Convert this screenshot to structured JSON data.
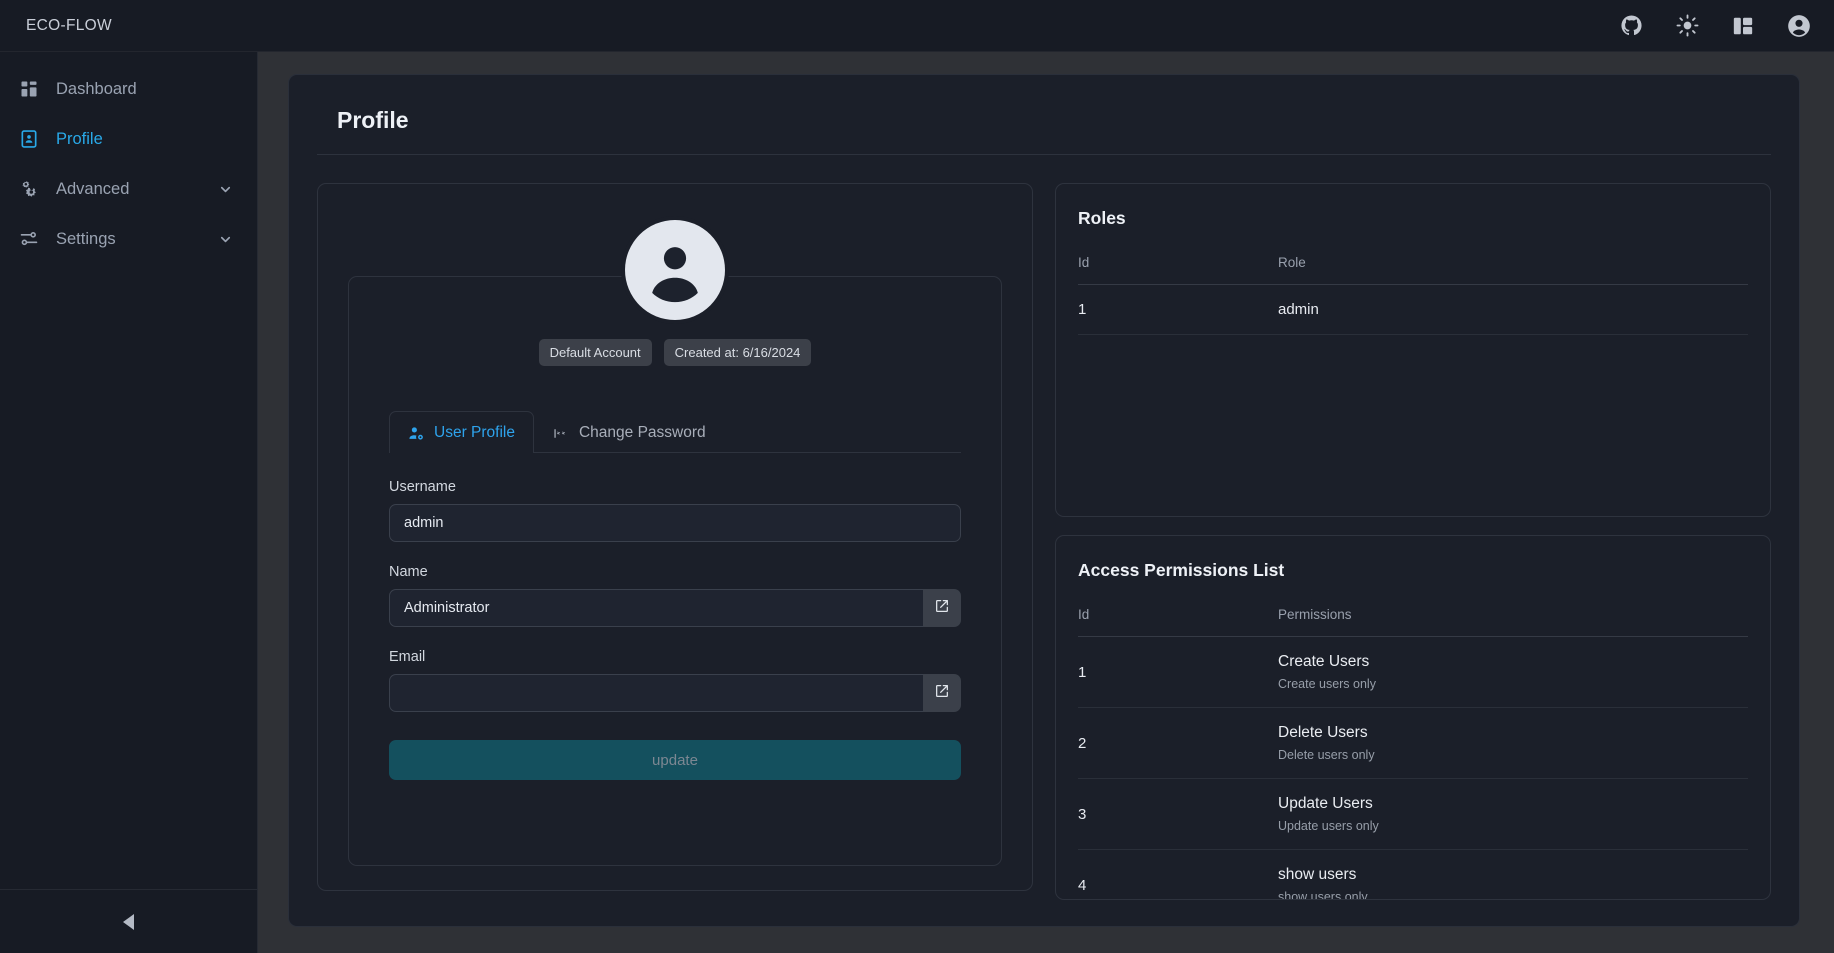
{
  "topbar": {
    "brand": "ECO-FLOW",
    "icons": [
      {
        "name": "github-icon",
        "label": "GitHub"
      },
      {
        "name": "sun-icon",
        "label": "Toggle theme"
      },
      {
        "name": "layout-panel-icon",
        "label": "Layout"
      },
      {
        "name": "account-circle-icon",
        "label": "Account"
      }
    ]
  },
  "sidebar": {
    "items": [
      {
        "label": "Dashboard",
        "icon": "dashboard-grid-icon",
        "active": false,
        "expandable": false
      },
      {
        "label": "Profile",
        "icon": "profile-card-icon",
        "active": true,
        "expandable": false
      },
      {
        "label": "Advanced",
        "icon": "gear-settings-icon",
        "active": false,
        "expandable": true
      },
      {
        "label": "Settings",
        "icon": "sliders-icon",
        "active": false,
        "expandable": true
      }
    ],
    "collapse_label": "Collapse sidebar"
  },
  "page": {
    "title": "Profile"
  },
  "profile": {
    "avatar_alt": "User avatar",
    "badges": [
      "Default Account",
      "Created at: 6/16/2024"
    ],
    "tabs": [
      {
        "label": "User Profile",
        "icon": "user-cog-icon",
        "active": true
      },
      {
        "label": "Change Password",
        "icon": "password-field-icon",
        "active": false
      }
    ],
    "fields": {
      "username": {
        "label": "Username",
        "value": "admin",
        "placeholder": "",
        "editable": false
      },
      "name": {
        "label": "Name",
        "value": "Administrator",
        "placeholder": "",
        "editable": true
      },
      "email": {
        "label": "Email",
        "value": "",
        "placeholder": "",
        "editable": true
      }
    },
    "update_label": "update"
  },
  "roles": {
    "title": "Roles",
    "columns": [
      "Id",
      "Role"
    ],
    "rows": [
      {
        "id": "1",
        "role": "admin"
      }
    ]
  },
  "permissions": {
    "title": "Access Permissions List",
    "columns": [
      "Id",
      "Permissions"
    ],
    "rows": [
      {
        "id": "1",
        "name": "Create Users",
        "desc": "Create users only"
      },
      {
        "id": "2",
        "name": "Delete Users",
        "desc": "Delete users only"
      },
      {
        "id": "3",
        "name": "Update Users",
        "desc": "Update users only"
      },
      {
        "id": "4",
        "name": "show users",
        "desc": "show users only"
      }
    ]
  },
  "colors": {
    "accent": "#29a9e8",
    "tab_active": "#2ea3ec",
    "update_button": "#14505e",
    "sidebar_bg": "#171b24",
    "panel_bg": "#1b1f29",
    "app_bg": "#2f3136"
  }
}
